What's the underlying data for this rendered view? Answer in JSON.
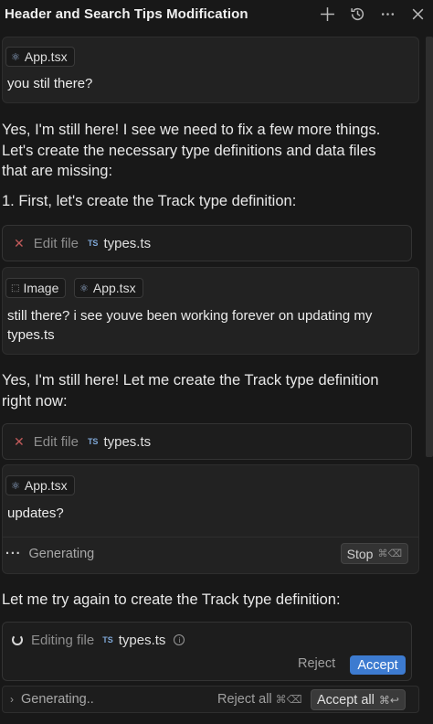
{
  "header": {
    "title": "Header and Search Tips Modification",
    "icons": [
      "plus-icon",
      "history-icon",
      "more-icon",
      "close-icon"
    ]
  },
  "messages": [
    {
      "chips": [
        "App.tsx"
      ],
      "text": "you stil there?"
    },
    {
      "chips": [
        "Image",
        "App.tsx"
      ],
      "text_line1": "still there? i see youve been working forever on updating my",
      "text_line2": "types.ts"
    },
    {
      "chips": [
        "App.tsx"
      ],
      "text": "updates?",
      "status": "Generating",
      "stop_label": "Stop",
      "stop_shortcut": "⌘⌫"
    }
  ],
  "replies": {
    "r1_line1": "Yes, I'm still here! I see we need to fix a few more things.",
    "r1_line2": "Let's create the necessary type definitions and data files",
    "r1_line3": "that are missing:",
    "r1_step": "1. First, let's create the Track type definition:",
    "r2_line1": "Yes, I'm still here! Let me create the Track type definition",
    "r2_line2": "right now:",
    "r3": "Let me try again to create the Track type definition:"
  },
  "file_actions": [
    {
      "action": "Edit file",
      "badge": "TS",
      "file": "types.ts"
    },
    {
      "action": "Edit file",
      "badge": "TS",
      "file": "types.ts"
    }
  ],
  "editing": {
    "action": "Editing file",
    "badge": "TS",
    "file": "types.ts",
    "reject_label": "Reject",
    "accept_label": "Accept"
  },
  "bottom_bar": {
    "status": "Generating..",
    "reject_all_label": "Reject all",
    "reject_all_shortcut": "⌘⌫",
    "accept_all_label": "Accept all",
    "accept_all_shortcut": "⌘↩"
  },
  "colors": {
    "background": "#181818",
    "accent": "#3d7bd0",
    "reject_x": "#c15a5a",
    "ts_badge": "#7fa8d8"
  }
}
